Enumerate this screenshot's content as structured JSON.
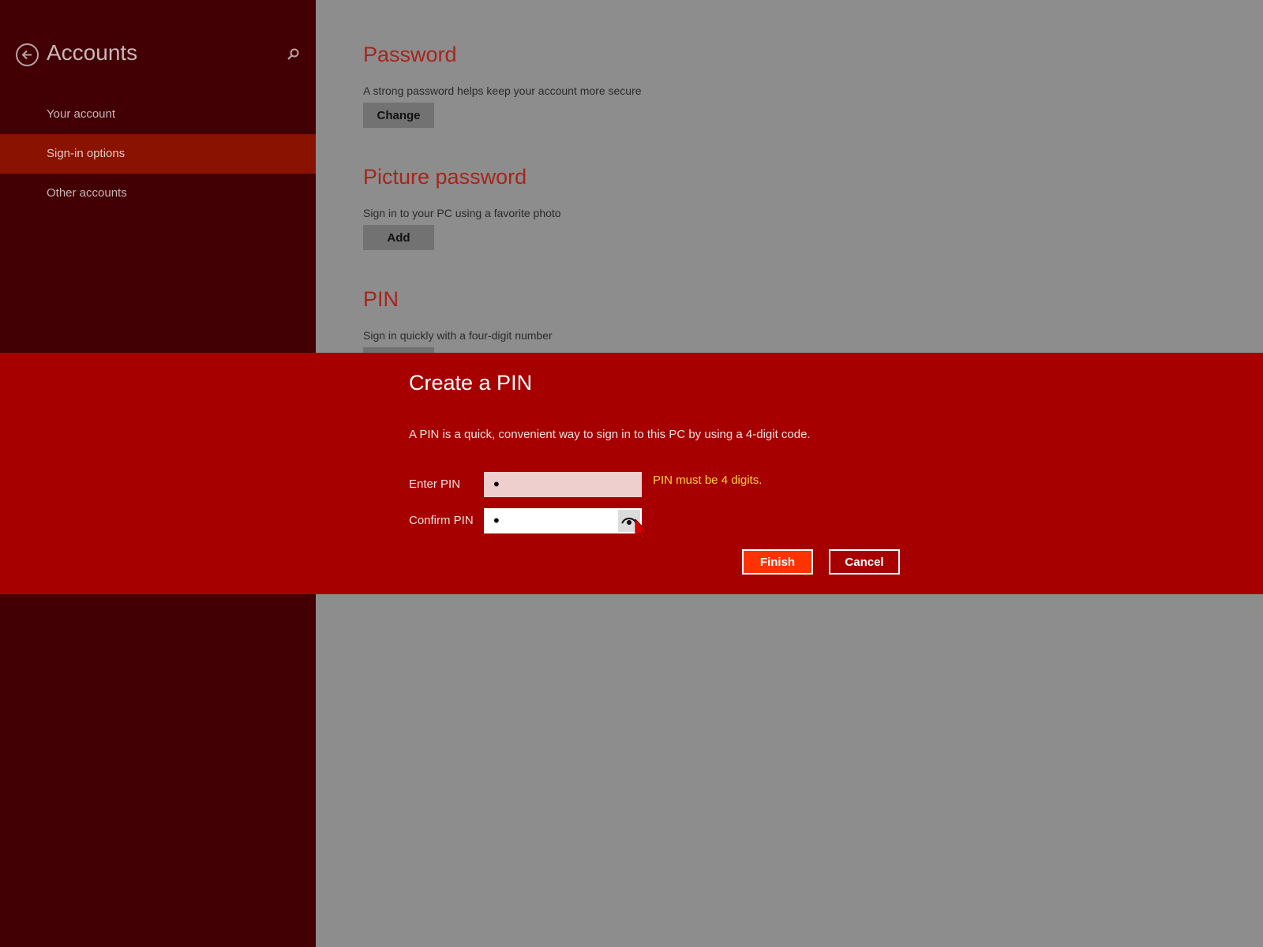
{
  "sidebar": {
    "title": "Accounts",
    "back_icon": "back-arrow-icon",
    "search_icon": "search-icon",
    "items": [
      {
        "label": "Your account",
        "active": false
      },
      {
        "label": "Sign-in options",
        "active": true
      },
      {
        "label": "Other accounts",
        "active": false
      }
    ]
  },
  "main": {
    "sections": [
      {
        "title": "Password",
        "description": "A strong password helps keep your account more secure",
        "button": "Change"
      },
      {
        "title": "Picture password",
        "description": "Sign in to your PC using a favorite photo",
        "button": "Add"
      },
      {
        "title": "PIN",
        "description": "Sign in quickly with a four-digit number"
      }
    ]
  },
  "dialog": {
    "title": "Create a PIN",
    "description": "A PIN is a quick, convenient way to sign in to this PC by using a 4-digit code.",
    "enter_pin_label": "Enter PIN",
    "enter_pin_value": "•",
    "confirm_pin_label": "Confirm PIN",
    "confirm_pin_value": "•",
    "reveal_icon": "eye-icon",
    "error_message": "PIN must be 4 digits.",
    "finish_label": "Finish",
    "cancel_label": "Cancel"
  },
  "colors": {
    "sidebar_bg": "#420004",
    "sidebar_active": "#8a1200",
    "content_bg": "#8d8d8d",
    "accent_title": "#a6251c",
    "dialog_bg": "#a60000",
    "finish_bg": "#ff3300",
    "error_text": "#ffd23a"
  }
}
